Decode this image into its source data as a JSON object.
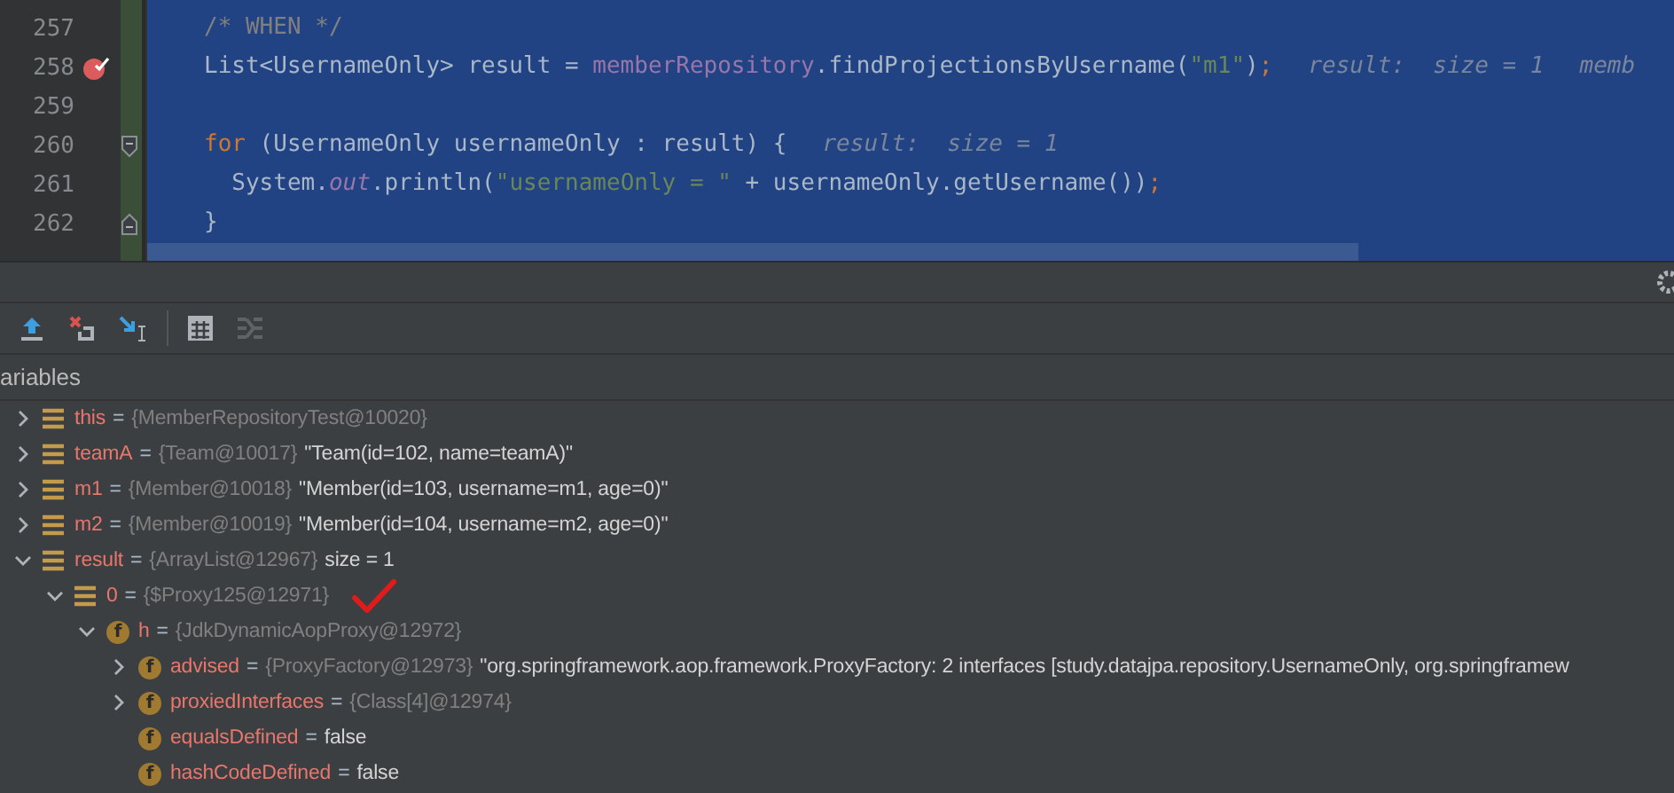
{
  "editor": {
    "lines": [
      {
        "number": "257",
        "tokens": [
          {
            "kind": "comment",
            "text": "/* WHEN */"
          }
        ]
      },
      {
        "number": "258",
        "breakpoint": true,
        "tokens": [
          {
            "kind": "plain",
            "text": "List<UsernameOnly> result = "
          },
          {
            "kind": "field",
            "text": "memberRepository"
          },
          {
            "kind": "plain",
            "text": ".findProjectionsByUsername("
          },
          {
            "kind": "string",
            "text": "\"m1\""
          },
          {
            "kind": "plain",
            "text": ")"
          },
          {
            "kind": "keyword",
            "text": ";"
          },
          {
            "kind": "hint",
            "text": "result:  size = 1"
          },
          {
            "kind": "hint",
            "text": "memb"
          }
        ]
      },
      {
        "number": "259"
      },
      {
        "number": "260",
        "fold_start": true,
        "tokens": [
          {
            "kind": "keyword",
            "text": "for"
          },
          {
            "kind": "plain",
            "text": " (UsernameOnly usernameOnly : result) {"
          },
          {
            "kind": "hint",
            "text": "result:  size = 1"
          }
        ]
      },
      {
        "number": "261",
        "tokens": [
          {
            "kind": "plain",
            "text": "  System."
          },
          {
            "kind": "static",
            "text": "out"
          },
          {
            "kind": "plain",
            "text": ".println("
          },
          {
            "kind": "string",
            "text": "\"usernameOnly = \""
          },
          {
            "kind": "plain",
            "text": " + usernameOnly.getUsername())"
          },
          {
            "kind": "keyword",
            "text": ";"
          }
        ]
      },
      {
        "number": "262",
        "fold_end": true,
        "tokens": [
          {
            "kind": "plain",
            "text": "}"
          }
        ]
      }
    ]
  },
  "debugger": {
    "panel_title": "ariables",
    "variables": [
      {
        "kind": "local",
        "name": "this",
        "eq": "=",
        "expanded": false,
        "type": "{MemberRepositoryTest@10020}"
      },
      {
        "kind": "local",
        "name": "teamA",
        "eq": "=",
        "expanded": false,
        "type": "{Team@10017}",
        "value": "\"Team(id=102, name=teamA)\""
      },
      {
        "kind": "local",
        "name": "m1",
        "eq": "=",
        "expanded": false,
        "type": "{Member@10018}",
        "value": "\"Member(id=103, username=m1, age=0)\""
      },
      {
        "kind": "local",
        "name": "m2",
        "eq": "=",
        "expanded": false,
        "type": "{Member@10019}",
        "value": "\"Member(id=104, username=m2, age=0)\""
      },
      {
        "kind": "local",
        "name": "result",
        "eq": "=",
        "expanded": true,
        "type": "{ArrayList@12967}",
        "value": "size = 1",
        "children": [
          {
            "kind": "local",
            "name": "0",
            "eq": "=",
            "expanded": true,
            "type": "{$Proxy125@12971}",
            "marked": true,
            "children": [
              {
                "kind": "field",
                "badge": "f",
                "name": "h",
                "eq": "=",
                "expanded": true,
                "type": "{JdkDynamicAopProxy@12972}",
                "children": [
                  {
                    "kind": "field",
                    "badge": "f",
                    "name": "advised",
                    "eq": "=",
                    "expanded": false,
                    "type": "{ProxyFactory@12973}",
                    "value": "\"org.springframework.aop.framework.ProxyFactory: 2 interfaces [study.datajpa.repository.UsernameOnly, org.springframew"
                  },
                  {
                    "kind": "field",
                    "badge": "f",
                    "name": "proxiedInterfaces",
                    "eq": "=",
                    "expanded": false,
                    "type": "{Class[4]@12974}"
                  },
                  {
                    "kind": "field",
                    "badge": "f",
                    "name": "equalsDefined",
                    "eq": "=",
                    "value": "false"
                  },
                  {
                    "kind": "field",
                    "badge": "f",
                    "name": "hashCodeDefined",
                    "eq": "=",
                    "value": "false"
                  }
                ]
              }
            ]
          }
        ]
      }
    ]
  }
}
